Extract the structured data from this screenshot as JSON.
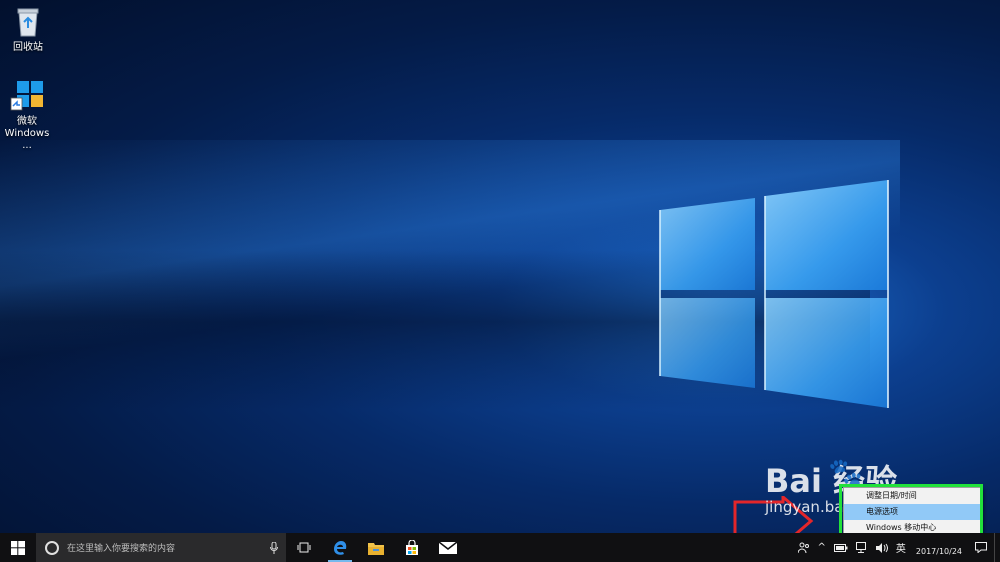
{
  "desktop": {
    "icons": [
      {
        "label": "回收站",
        "icon": "recycle-bin-icon"
      },
      {
        "label": "微软\nWindows ...",
        "line1": "微软",
        "line2": "Windows ...",
        "icon": "windows-installer-icon"
      }
    ]
  },
  "watermark": {
    "big": "Bai  经验",
    "small": "jingyan.baidu"
  },
  "context_menu": {
    "items": [
      {
        "label": "调整日期/时间"
      },
      {
        "label": "电源选项",
        "highlighted": true
      },
      {
        "label": "Windows 移动中心"
      }
    ]
  },
  "taskbar": {
    "search_placeholder": "在这里输入你要搜索的内容",
    "apps": [
      "task-view-icon",
      "edge-icon",
      "file-explorer-icon",
      "store-icon",
      "mail-icon"
    ],
    "tray": {
      "ime": "英",
      "time": "",
      "date": "2017/10/24"
    }
  },
  "colors": {
    "taskbar": "#101012",
    "highlight": "#22e13a",
    "arrow": "#e3262a",
    "menu_hover": "#91c9f7"
  }
}
